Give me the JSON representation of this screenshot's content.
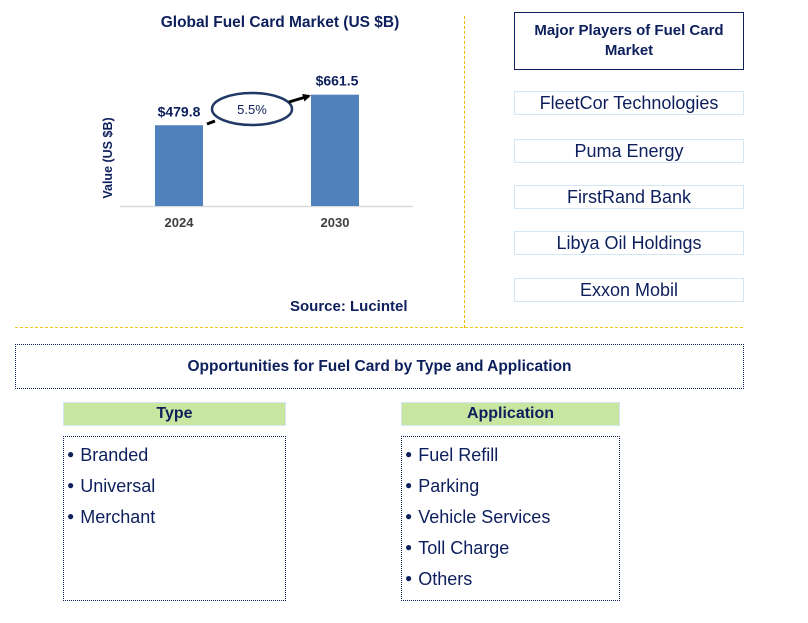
{
  "chart_data": {
    "type": "bar",
    "title": "Global Fuel Card Market (US $B)",
    "xlabel": "",
    "ylabel": "Value (US $B)",
    "categories": [
      "2024",
      "2030"
    ],
    "values": [
      479.8,
      661.5
    ],
    "data_labels": [
      "$479.8",
      "$661.5"
    ],
    "ylim": [
      0,
      750
    ],
    "grid": false,
    "annotation": {
      "text": "5.5%",
      "meaning": "CAGR 2024-2030"
    },
    "bar_color": "#4f81bd"
  },
  "source": "Source: Lucintel",
  "players": {
    "title": "Major Players of Fuel Card Market",
    "items": [
      "FleetCor Technologies",
      "Puma Energy",
      "FirstRand Bank",
      "Libya Oil Holdings",
      "Exxon Mobil"
    ]
  },
  "opportunities": {
    "title": "Opportunities for Fuel Card by Type and Application",
    "type": {
      "header": "Type",
      "items": [
        "Branded",
        "Universal",
        "Merchant"
      ]
    },
    "application": {
      "header": "Application",
      "items": [
        "Fuel Refill",
        "Parking",
        "Vehicle Services",
        "Toll Charge",
        "Others"
      ]
    }
  },
  "colors": {
    "text": "#0d1f5c",
    "divider": "#f5b800",
    "header_fill": "#c8e6a0",
    "player_border": "#d3e6f3"
  }
}
